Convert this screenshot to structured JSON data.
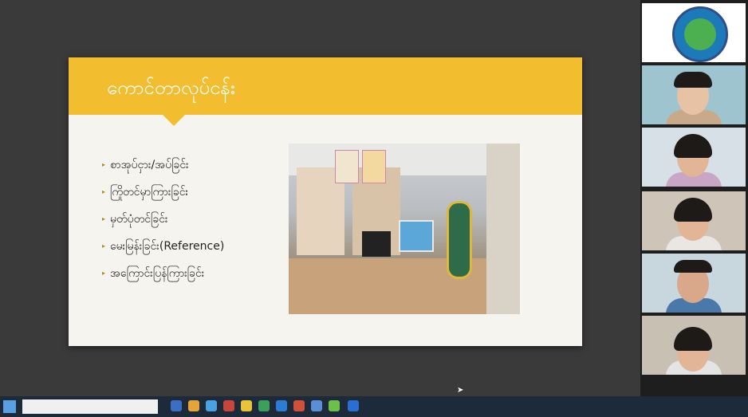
{
  "slide": {
    "title": "ကောင်တာလုပ်ငန်း",
    "bullets": [
      "စာအုပ်ငှား/အပ်ခြင်း",
      "ကြိုတင်မှာကြားခြင်း",
      "မှတ်ပုံတင်ခြင်း",
      "မေးမြန်းခြင်း(Reference)",
      "အကြောင်းပြန်ကြားခြင်း"
    ],
    "header_color": "#f2bd2f",
    "background_color": "#f6f4ef"
  },
  "participants": [
    {
      "type": "logo"
    },
    {
      "type": "video"
    },
    {
      "type": "video"
    },
    {
      "type": "video"
    },
    {
      "type": "video"
    },
    {
      "type": "video"
    }
  ]
}
